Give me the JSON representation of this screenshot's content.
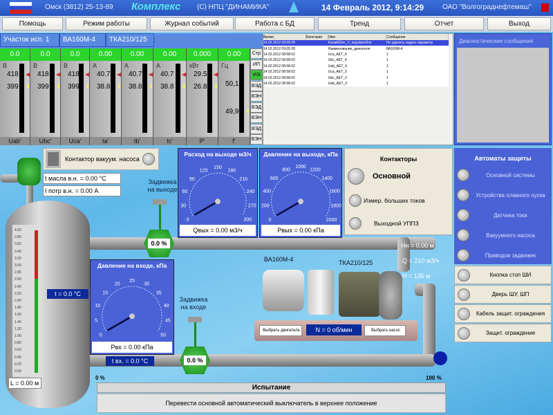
{
  "titlebar": {
    "phone": "Омск (3812) 25-13-89",
    "logo": "Комплекс",
    "copyright": "(С) НПЦ \"ДИНАМИКА\"",
    "datetime": "14 Февраль 2012, 9:14:29",
    "company": "ОАО \"Волгограднефтемаш\""
  },
  "menu": [
    "Помощь",
    "Режим работы",
    "Журнал событий",
    "Работа с БД",
    "Тренд",
    "Отчет",
    "Выход"
  ],
  "tabs": [
    "Участок исп. 1",
    "ВА160М-4",
    "ТКА210/125"
  ],
  "meters": [
    {
      "value": "0.0",
      "unit": "В",
      "hi": "418",
      "lo": "399",
      "label": "Uab'"
    },
    {
      "value": "0.0",
      "unit": "В",
      "hi": "418",
      "lo": "399",
      "label": "Ubc'"
    },
    {
      "value": "0.0",
      "unit": "В",
      "hi": "418",
      "lo": "399",
      "label": "Uca'"
    },
    {
      "value": "0.00",
      "unit": "А",
      "hi": "40.7",
      "lo": "38.8",
      "label": "Ia'"
    },
    {
      "value": "0.00",
      "unit": "А",
      "hi": "40.7",
      "lo": "38.8",
      "label": "Ib'"
    },
    {
      "value": "0.00",
      "unit": "А",
      "hi": "40.7",
      "lo": "38.8",
      "label": "Ic'"
    },
    {
      "value": "0.000",
      "unit": "кВт",
      "hi": "29.5",
      "lo": "26.8",
      "label": "P'"
    },
    {
      "value": "0.00",
      "unit": "Гц",
      "hi": "50,1",
      "lo": "49,9",
      "label": "f'"
    }
  ],
  "side_buttons": [
    "Стр",
    "ИП",
    "ИЭ",
    "ВЭД",
    "ВЭН",
    "ВЭД",
    "ВЭН",
    "ВЭД",
    "ВЭН"
  ],
  "events": {
    "columns": [
      "Время",
      "Категория",
      "Имя",
      "Сообщение"
    ],
    "rows": [
      [
        "14.02.2012 09:09:28",
        "",
        "KanalEDnc_V_regulatorOne",
        "Не удалось задать параметр"
      ],
      [
        "14.02.2012 09:05:28",
        "",
        "Наименование_двигателя",
        "ВА160М-4"
      ],
      [
        "14.02.2012 08:58:02",
        "",
        "Uca_AET_4",
        "1"
      ],
      [
        "14.02.2012 08:58:02",
        "",
        "Ubc_AET_4",
        "1"
      ],
      [
        "14.02.2012 08:58:02",
        "",
        "Uab_AET_4",
        "1"
      ],
      [
        "14.02.2012 08:58:02",
        "",
        "Uca_AET_3",
        "1"
      ],
      [
        "14.02.2012 08:58:02",
        "",
        "Ubc_AET_3",
        "1"
      ],
      [
        "14.02.2012 08:58:02",
        "",
        "Uab_AET_3",
        "1"
      ]
    ]
  },
  "diagnostics": {
    "title": "Диагностические сообщения"
  },
  "vacuum": {
    "label": "Контактор вакуум. насоса",
    "oil_temp": "t масла в.н. = 0.00 °С",
    "current": "I потр в.н. = 0.00 А"
  },
  "gauges": {
    "flow_out": {
      "title": "Расход на выходе м3/ч",
      "ticks": [
        "0",
        "30",
        "60",
        "90",
        "120",
        "150",
        "180",
        "210",
        "240",
        "270",
        "300"
      ],
      "value": 0,
      "max": 300,
      "readout": "Qвых = 0.00 м3/ч"
    },
    "pressure_out": {
      "title": "Давление на выходе, кПа",
      "ticks": [
        "0",
        "200",
        "400",
        "600",
        "800",
        "1000",
        "1200",
        "1400",
        "1600",
        "1800",
        "2000"
      ],
      "value": 0,
      "max": 2000,
      "readout": "Pвых = 0.00 кПа"
    },
    "pressure_in": {
      "title": "Давление на входе, кПа",
      "ticks": [
        "0",
        "5",
        "10",
        "15",
        "20",
        "25",
        "30",
        "35",
        "40",
        "45",
        "50"
      ],
      "value": 0,
      "max": 50,
      "readout": "Pвх = 0.00 кПа"
    }
  },
  "contactors": {
    "title": "Контакторы",
    "items": [
      "Основной",
      "Измер. больших токов",
      "Выходной УППЗ"
    ]
  },
  "protection": {
    "title": "Автоматы защиты",
    "items": [
      "Основной системы",
      "Устройства плавного пуска",
      "Датчика тока",
      "Вакуумного насоса",
      "Приводов задвижек"
    ],
    "extra": [
      "Кнопка стоп ШИ",
      "Дверь ШУ, ШП",
      "Кабель защит. ограждения",
      "Защит. ограждение"
    ]
  },
  "tank": {
    "scale": [
      "4.00",
      "3.80",
      "3.60",
      "3.40",
      "3.20",
      "3.00",
      "2.80",
      "2.60",
      "2.40",
      "2.20",
      "2.00",
      "1.80",
      "1.60",
      "1.40",
      "1.20",
      "1.00",
      "0.80",
      "0.60",
      "0.40",
      "0.20",
      "0.00"
    ],
    "temp": "t = 0.0 °С",
    "level": "L = 0.00 м"
  },
  "valves": {
    "out_label": "Задвижка на выходе",
    "out_pct": "0.0 %",
    "in_label": "Задвижка на входе",
    "in_pct": "0.0 %"
  },
  "inlet_temp": "t вх. = 0.0 °С",
  "pump": {
    "motor": "ВА160М-4",
    "pump": "ТКА210/125",
    "hn": "Hн = 0.00 м",
    "q": "Q = 210 м3/ч",
    "h": "H = 135 м",
    "select_motor": "Выбрать двигатель",
    "speed": "N = 0 об/мин",
    "select_pump": "Выбрать насос"
  },
  "progress": {
    "min": "0 %",
    "max": "100 %",
    "value": 0
  },
  "status": {
    "title": "Испытание",
    "message": "Перевести основной автоматический выключатель в верхнее положение"
  },
  "colors": {
    "titlebar": "#2a56c0",
    "green": "#2bd52b",
    "gauge": "#4a62d6",
    "navy": "#0c2a9a"
  }
}
